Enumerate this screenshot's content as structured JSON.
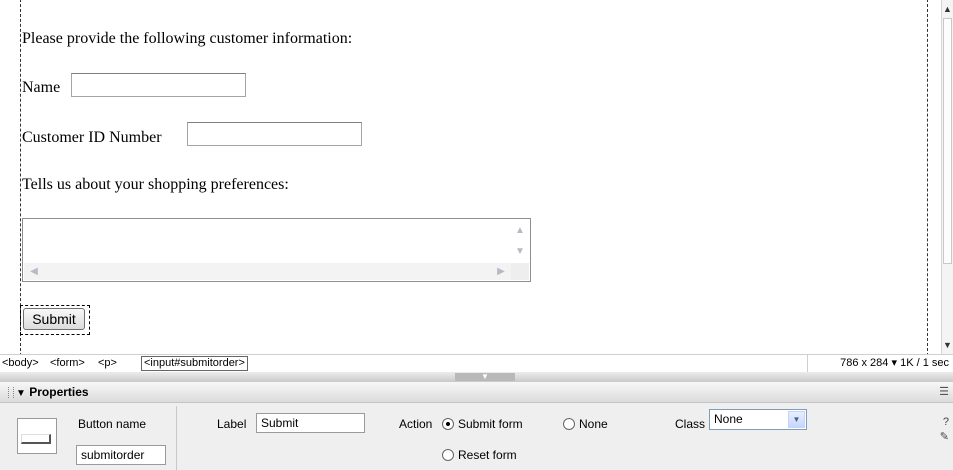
{
  "design": {
    "intro_text": "Please provide the following customer information:",
    "name_label": "Name",
    "name_value": "",
    "customer_id_label": "Customer ID Number",
    "customer_id_value": "",
    "preferences_text": "Tells us about your shopping preferences:",
    "preferences_value": "",
    "submit_label": "Submit"
  },
  "status_bar": {
    "tags": [
      "<body>",
      "<form>",
      "<p>"
    ],
    "selected_tag": "<input#submitorder>",
    "window_size": "786 x 284",
    "dropdown_glyph": "▾",
    "download": "1K / 1 sec"
  },
  "properties": {
    "title": "Properties",
    "button_name_label": "Button name",
    "button_name_value": "submitorder",
    "label_label": "Label",
    "label_value": "Submit",
    "action_label": "Action",
    "action_options": [
      {
        "label": "Submit form",
        "selected": true
      },
      {
        "label": "None",
        "selected": false
      },
      {
        "label": "Reset form",
        "selected": false
      }
    ],
    "class_label": "Class",
    "class_value": "None"
  },
  "icons": {
    "collapse": "▼",
    "up": "▲",
    "down": "▼",
    "left": "◀",
    "right": "▶",
    "help": "?",
    "edit": "✎",
    "options": "☰"
  }
}
